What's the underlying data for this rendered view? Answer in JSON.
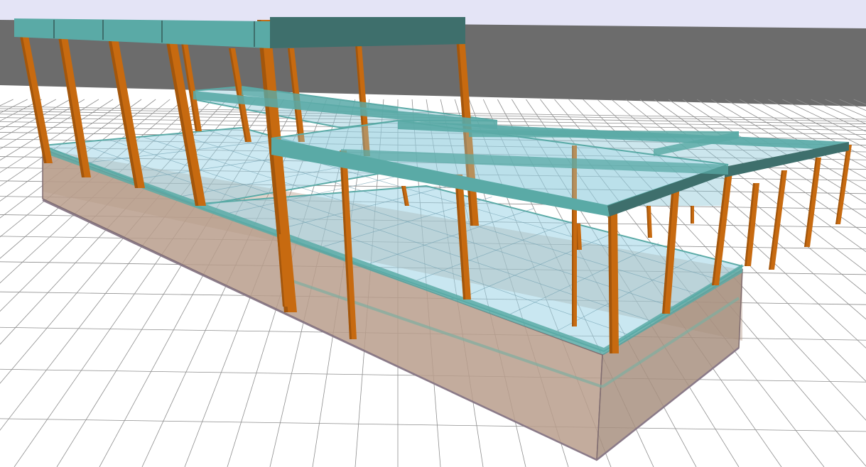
{
  "viewport": {
    "kind": "3d-structural-model-view",
    "projection": "perspective",
    "background": {
      "sky": "#e4e4f6",
      "far_ground": "#6c6c6c",
      "ground": "#ffffff",
      "grid_lines": "#8e8e8e"
    }
  },
  "colors": {
    "column": "#c76a10",
    "column_dark": "#8a4a0a",
    "beam": "#5aaaa6",
    "beam_dark": "#3e6f6c",
    "slab": "#9cd4e6",
    "wall": "#b89e8c",
    "wall_dark": "#7f6c70"
  },
  "model": {
    "visible_elements": [
      "basement-wall",
      "ground-floor-slab",
      "upper-floor-slab",
      "columns",
      "perimeter-beams",
      "roof-beams"
    ],
    "render_style": "semi-transparent"
  }
}
